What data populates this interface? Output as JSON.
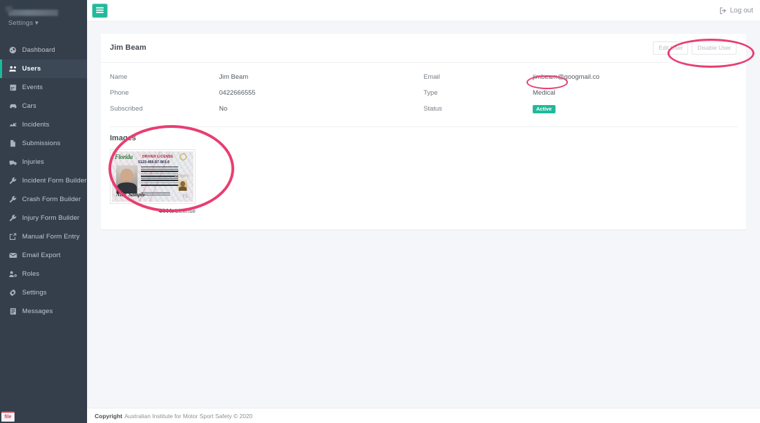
{
  "sidebar": {
    "user_name_redacted": "",
    "settings_label": "Settings",
    "settings_caret": "▾",
    "items": [
      {
        "label": "Dashboard",
        "icon": "dashboard-icon",
        "active": false
      },
      {
        "label": "Users",
        "icon": "users-icon",
        "active": true
      },
      {
        "label": "Events",
        "icon": "calendar-icon",
        "active": false
      },
      {
        "label": "Cars",
        "icon": "car-icon",
        "active": false
      },
      {
        "label": "Incidents",
        "icon": "incidents-icon",
        "active": false
      },
      {
        "label": "Submissions",
        "icon": "document-icon",
        "active": false
      },
      {
        "label": "Injuries",
        "icon": "injuries-icon",
        "active": false
      },
      {
        "label": "Incident Form Builder",
        "icon": "wrench-icon",
        "active": false
      },
      {
        "label": "Crash Form Builder",
        "icon": "wrench-icon",
        "active": false
      },
      {
        "label": "Injury Form Builder",
        "icon": "wrench-icon",
        "active": false
      },
      {
        "label": "Manual Form Entry",
        "icon": "pencil-square-icon",
        "active": false
      },
      {
        "label": "Email Export",
        "icon": "envelope-icon",
        "active": false
      },
      {
        "label": "Roles",
        "icon": "user-gear-icon",
        "active": false
      },
      {
        "label": "Settings",
        "icon": "gear-icon",
        "active": false
      },
      {
        "label": "Messages",
        "icon": "inbox-icon",
        "active": false
      }
    ],
    "corner_badge": "file"
  },
  "topbar": {
    "menu_toggle_icon": "hamburger-icon",
    "logout_label": "Log out",
    "logout_icon": "logout-icon"
  },
  "user_card": {
    "title": "Jim Beam",
    "edit_button": "Edit User",
    "disable_button": "Disable User",
    "fields": [
      {
        "label": "Name",
        "value": "Jim Beam"
      },
      {
        "label": "Email",
        "value": "jimbeam@googmail.co"
      },
      {
        "label": "Phone",
        "value": "0422666555"
      },
      {
        "label": "Type",
        "value": "Medical"
      },
      {
        "label": "Subscribed",
        "value": "No"
      },
      {
        "label": "Status",
        "value": "Active"
      }
    ],
    "status_badge": "Active",
    "status_badge_color": "#20b99a"
  },
  "images_section": {
    "heading": "Images",
    "items": [
      {
        "caption_id": "4444:",
        "caption_label": "License",
        "alt": "Florida driver license sample",
        "license": {
          "state": "Florida",
          "doc_type": "DRIVER LICENSE",
          "number": "5123-456-57-901-0",
          "signature": "Nick Sample",
          "state_abbr": "FL",
          "ghost_label": "VERIFY"
        }
      }
    ]
  },
  "footer": {
    "copyright_bold": "Copyright",
    "copyright_text": "Australian Institute for Motor Sport Safety © 2020"
  },
  "annotations": {
    "color": "#e83e72",
    "marks": [
      {
        "name": "annotation-ellipse-buttons",
        "target": "Edit User / Disable User buttons"
      },
      {
        "name": "annotation-ellipse-type",
        "target": "Type value Medical"
      },
      {
        "name": "annotation-ellipse-image",
        "target": "License thumbnail"
      }
    ]
  }
}
